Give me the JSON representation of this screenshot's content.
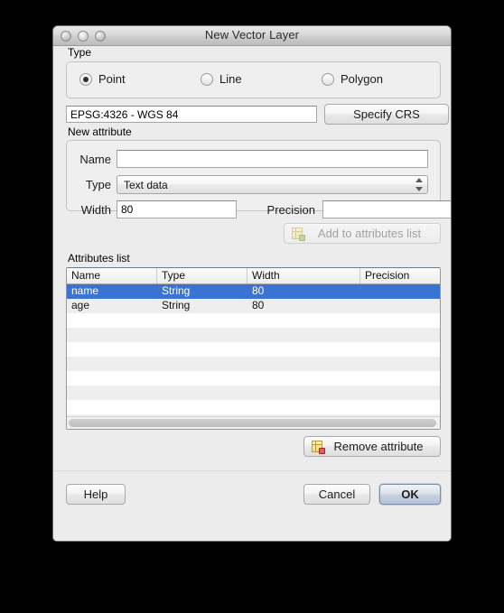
{
  "window": {
    "title": "New Vector Layer",
    "controls": [
      "close-button",
      "minimize-button",
      "zoom-button"
    ]
  },
  "type_group": {
    "label": "Type",
    "options": [
      {
        "label": "Point",
        "selected": true
      },
      {
        "label": "Line",
        "selected": false
      },
      {
        "label": "Polygon",
        "selected": false
      }
    ]
  },
  "crs": {
    "value": "EPSG:4326 - WGS 84",
    "button_label": "Specify CRS"
  },
  "new_attribute": {
    "label": "New attribute",
    "name_label": "Name",
    "name_value": "",
    "type_label": "Type",
    "type_value": "Text data",
    "width_label": "Width",
    "width_value": "80",
    "precision_label": "Precision",
    "precision_value": "",
    "add_button_label": "Add to attributes list",
    "add_button_icon": "add-table-row-icon",
    "add_button_enabled": false
  },
  "attributes_list": {
    "label": "Attributes list",
    "columns": [
      "Name",
      "Type",
      "Width",
      "Precision"
    ],
    "rows": [
      {
        "name": "name",
        "type": "String",
        "width": "80",
        "precision": "",
        "selected": true
      },
      {
        "name": "age",
        "type": "String",
        "width": "80",
        "precision": "",
        "selected": false
      }
    ],
    "remove_button_label": "Remove attribute",
    "remove_button_icon": "remove-table-row-icon"
  },
  "footer": {
    "help_label": "Help",
    "cancel_label": "Cancel",
    "ok_label": "OK"
  },
  "colors": {
    "selection_blue": "#3b73d4",
    "window_background": "#ececec",
    "desktop_background": "#000000"
  }
}
